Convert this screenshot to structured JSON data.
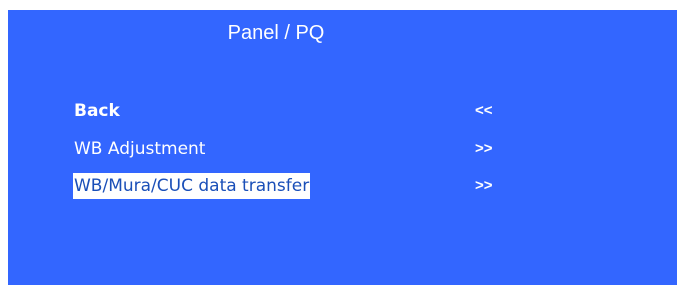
{
  "header": {
    "title": "Panel / PQ"
  },
  "menu": {
    "items": [
      {
        "label": "Back",
        "arrow": "<<"
      },
      {
        "label": "WB Adjustment",
        "arrow": ">>"
      },
      {
        "label": "WB/Mura/CUC data transfer",
        "arrow": ">>"
      }
    ]
  },
  "colors": {
    "background": "#3366ff",
    "text": "#ffffff",
    "selected_background": "#ffffff",
    "selected_text": "#1a4fb8"
  }
}
